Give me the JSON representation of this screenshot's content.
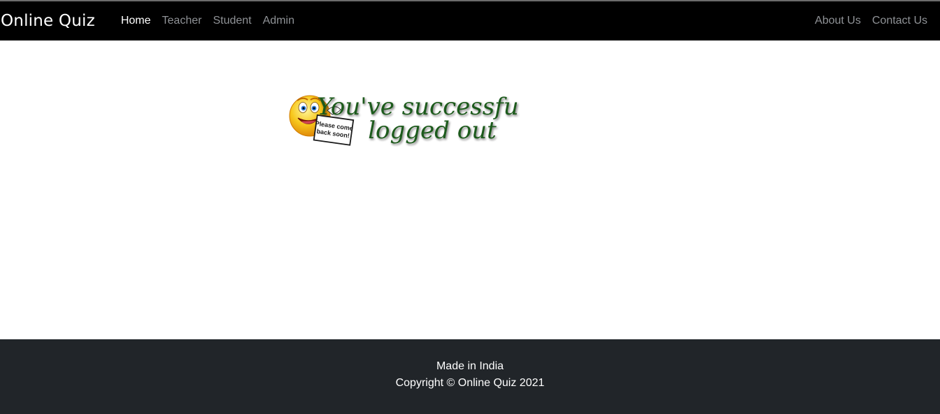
{
  "navbar": {
    "brand": "Online Quiz",
    "left_links": [
      {
        "label": "Home"
      },
      {
        "label": "Teacher"
      },
      {
        "label": "Student"
      },
      {
        "label": "Admin"
      }
    ],
    "right_links": [
      {
        "label": "About Us"
      },
      {
        "label": "Contact Us"
      }
    ]
  },
  "main": {
    "image": {
      "icon": "smiley-holding-sign-icon",
      "headline_line1": "You've successfully",
      "headline_line2": "logged out",
      "sign_line1": "Please come",
      "sign_line2": "back soon!"
    }
  },
  "footer": {
    "line1": "Made in India",
    "line2": "Copyright © Online Quiz 2021"
  },
  "colors": {
    "navbar_bg": "#000000",
    "footer_bg": "#212529",
    "nav_link": "#8f9296",
    "headline_green": "#1f5a1a"
  }
}
